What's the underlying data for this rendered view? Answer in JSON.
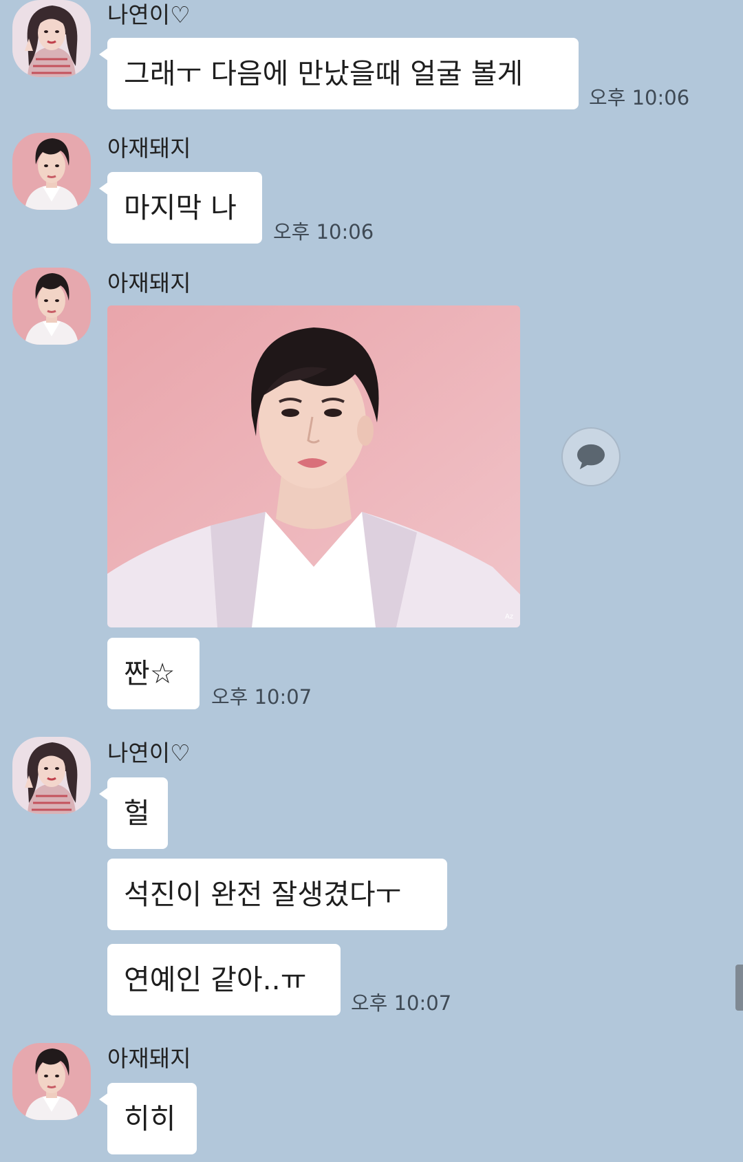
{
  "colors": {
    "background": "#b2c7da",
    "bubble": "#ffffff",
    "time_text": "#3f4a55",
    "photo_background": "#e8aeb3"
  },
  "messages": [
    {
      "sender": "나연이♡",
      "avatar": "female-profile-photo",
      "texts": [
        "그래ㅜ 다음에 만났을때 얼굴 볼게"
      ],
      "time": "오후 10:06"
    },
    {
      "sender": "아재돼지",
      "avatar": "male-profile-photo",
      "texts": [
        "마지막 나"
      ],
      "time": "오후 10:06"
    },
    {
      "sender": "아재돼지",
      "avatar": "male-profile-photo",
      "image": "portrait-photo-pink-background",
      "texts": [
        "짠☆"
      ],
      "time": "오후 10:07"
    },
    {
      "sender": "나연이♡",
      "avatar": "female-profile-photo",
      "texts": [
        "헐",
        "석진이 완전 잘생겼다ㅜ",
        "연예인 같아..ㅠ"
      ],
      "time": "오후 10:07"
    },
    {
      "sender": "아재돼지",
      "avatar": "male-profile-photo",
      "texts": [
        "히히"
      ]
    }
  ],
  "share_button_icon": "speech-bubble-icon"
}
